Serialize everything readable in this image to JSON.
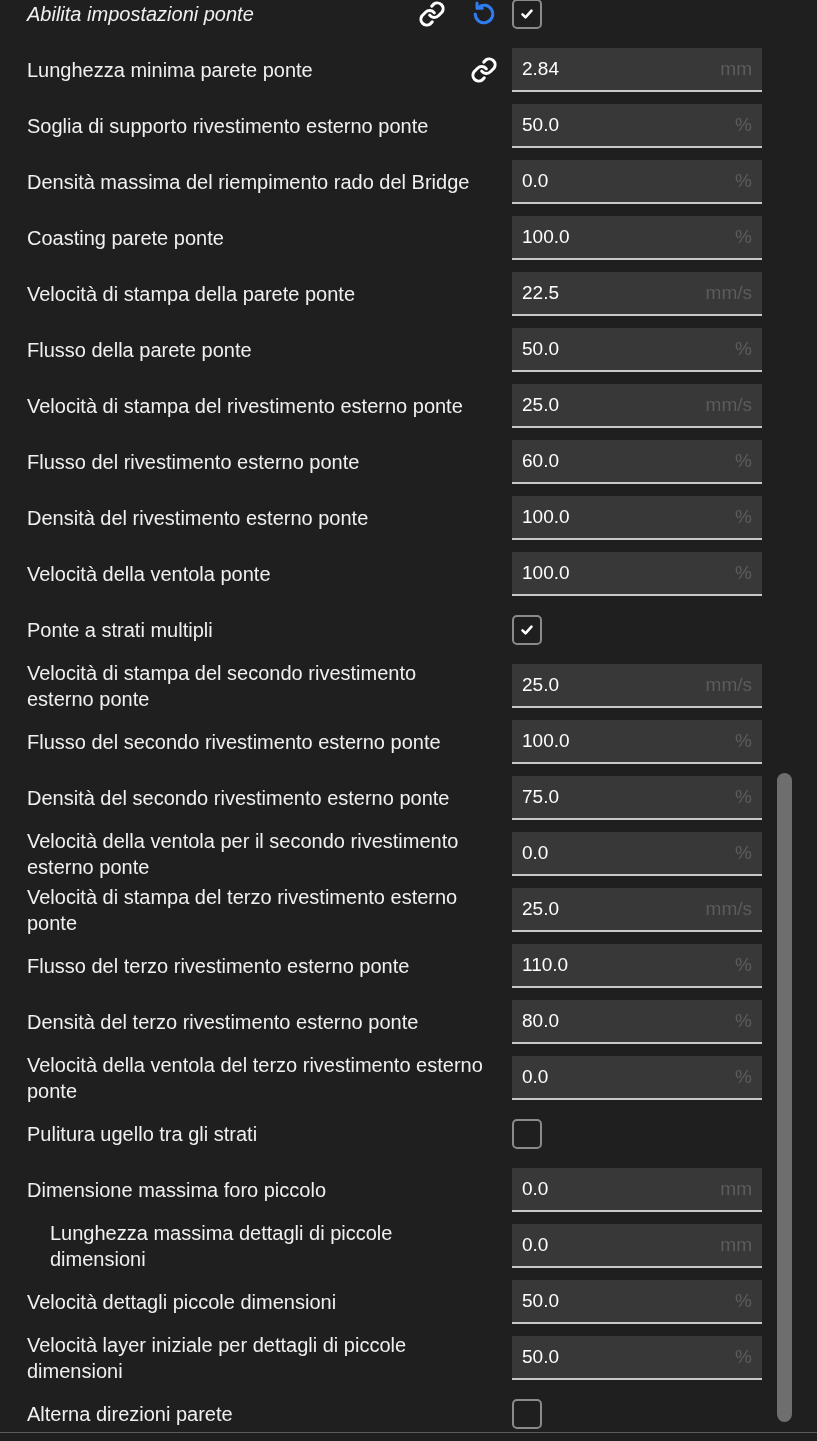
{
  "settings": [
    {
      "label": "Abilita impostazioni ponte",
      "kind": "checkbox",
      "checked": true,
      "modified": true,
      "linked": true,
      "resettable": true
    },
    {
      "label": "Lunghezza minima parete ponte",
      "kind": "input",
      "value": "2.84",
      "unit": "mm",
      "modified": false,
      "linked": true,
      "resettable": false
    },
    {
      "label": "Soglia di supporto rivestimento esterno ponte",
      "kind": "input",
      "value": "50.0",
      "unit": "%",
      "modified": false,
      "linked": false,
      "resettable": false
    },
    {
      "label": "Densità massima del riempimento rado del Bridge",
      "kind": "input",
      "value": "0.0",
      "unit": "%",
      "modified": false,
      "linked": false,
      "resettable": false
    },
    {
      "label": "Coasting parete ponte",
      "kind": "input",
      "value": "100.0",
      "unit": "%",
      "modified": false,
      "linked": false,
      "resettable": false
    },
    {
      "label": "Velocità di stampa della parete ponte",
      "kind": "input",
      "value": "22.5",
      "unit": "mm/s",
      "modified": false,
      "linked": false,
      "resettable": false
    },
    {
      "label": "Flusso della parete ponte",
      "kind": "input",
      "value": "50.0",
      "unit": "%",
      "modified": false,
      "linked": false,
      "resettable": false
    },
    {
      "label": "Velocità di stampa del rivestimento esterno ponte",
      "kind": "input",
      "value": "25.0",
      "unit": "mm/s",
      "modified": false,
      "linked": false,
      "resettable": false
    },
    {
      "label": "Flusso del rivestimento esterno ponte",
      "kind": "input",
      "value": "60.0",
      "unit": "%",
      "modified": false,
      "linked": false,
      "resettable": false
    },
    {
      "label": "Densità del rivestimento esterno ponte",
      "kind": "input",
      "value": "100.0",
      "unit": "%",
      "modified": false,
      "linked": false,
      "resettable": false
    },
    {
      "label": "Velocità della ventola ponte",
      "kind": "input",
      "value": "100.0",
      "unit": "%",
      "modified": false,
      "linked": false,
      "resettable": false
    },
    {
      "label": "Ponte a strati multipli",
      "kind": "checkbox",
      "checked": true,
      "modified": false,
      "linked": false,
      "resettable": false
    },
    {
      "label": "Velocità di stampa del secondo rivestimento esterno ponte",
      "kind": "input",
      "value": "25.0",
      "unit": "mm/s",
      "modified": false,
      "linked": false,
      "resettable": false
    },
    {
      "label": "Flusso del secondo rivestimento esterno ponte",
      "kind": "input",
      "value": "100.0",
      "unit": "%",
      "modified": false,
      "linked": false,
      "resettable": false
    },
    {
      "label": "Densità del secondo rivestimento esterno ponte",
      "kind": "input",
      "value": "75.0",
      "unit": "%",
      "modified": false,
      "linked": false,
      "resettable": false
    },
    {
      "label": "Velocità della ventola per il secondo rivestimento esterno ponte",
      "kind": "input",
      "value": "0.0",
      "unit": "%",
      "modified": false,
      "linked": false,
      "resettable": false
    },
    {
      "label": "Velocità di stampa del terzo rivestimento esterno ponte",
      "kind": "input",
      "value": "25.0",
      "unit": "mm/s",
      "modified": false,
      "linked": false,
      "resettable": false
    },
    {
      "label": "Flusso del terzo rivestimento esterno ponte",
      "kind": "input",
      "value": "110.0",
      "unit": "%",
      "modified": false,
      "linked": false,
      "resettable": false
    },
    {
      "label": "Densità del terzo rivestimento esterno ponte",
      "kind": "input",
      "value": "80.0",
      "unit": "%",
      "modified": false,
      "linked": false,
      "resettable": false
    },
    {
      "label": "Velocità della ventola del terzo rivestimento esterno ponte",
      "kind": "input",
      "value": "0.0",
      "unit": "%",
      "modified": false,
      "linked": false,
      "resettable": false
    },
    {
      "label": "Pulitura ugello tra gli strati",
      "kind": "checkbox",
      "checked": false,
      "modified": false,
      "linked": false,
      "resettable": false
    },
    {
      "label": "Dimensione massima foro piccolo",
      "kind": "input",
      "value": "0.0",
      "unit": "mm",
      "modified": false,
      "linked": false,
      "resettable": false,
      "children": [
        {
          "label": "Lunghezza massima dettagli di piccole dimensioni",
          "kind": "input",
          "value": "0.0",
          "unit": "mm",
          "modified": false,
          "linked": false,
          "resettable": false
        }
      ]
    },
    {
      "label": "Velocità dettagli piccole dimensioni",
      "kind": "input",
      "value": "50.0",
      "unit": "%",
      "modified": false,
      "linked": false,
      "resettable": false
    },
    {
      "label": "Velocità layer iniziale per dettagli di piccole dimensioni",
      "kind": "input",
      "value": "50.0",
      "unit": "%",
      "modified": false,
      "linked": false,
      "resettable": false
    },
    {
      "label": "Alterna direzioni parete",
      "kind": "checkbox",
      "checked": false,
      "modified": false,
      "linked": false,
      "resettable": false
    }
  ]
}
